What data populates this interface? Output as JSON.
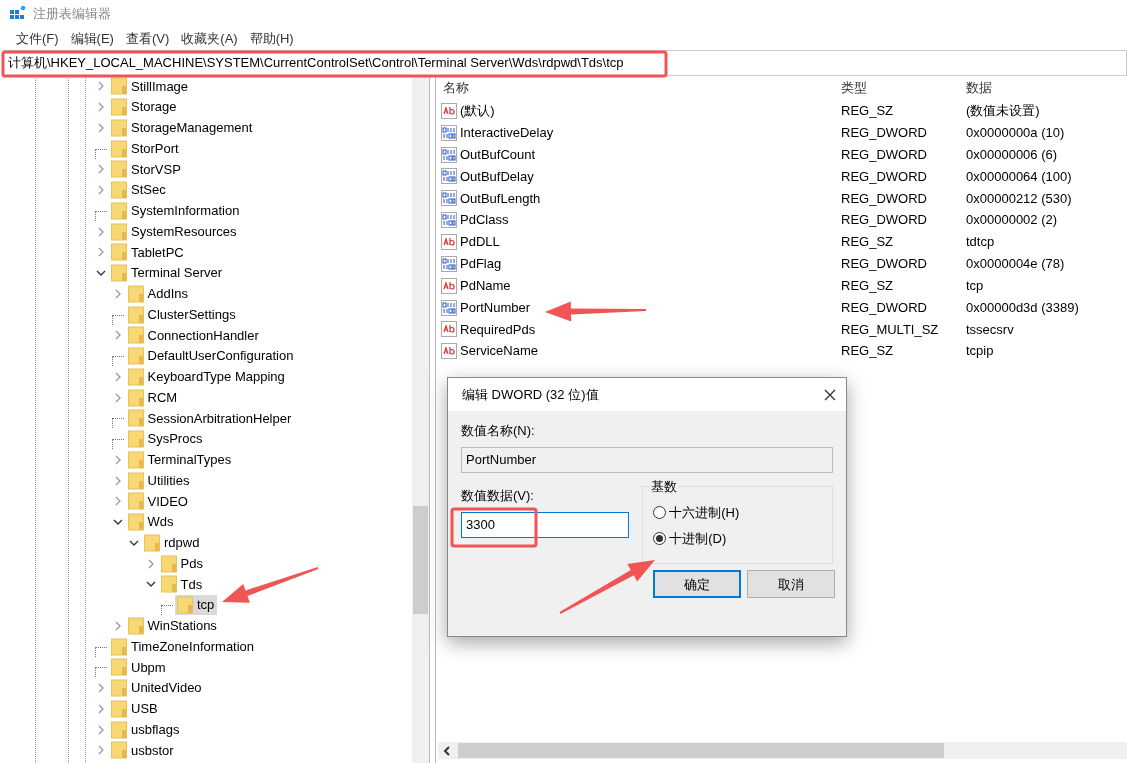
{
  "window": {
    "title": "注册表编辑器"
  },
  "menu": [
    "文件(F)",
    "编辑(E)",
    "查看(V)",
    "收藏夹(A)",
    "帮助(H)"
  ],
  "address": "计算机\\HKEY_LOCAL_MACHINE\\SYSTEM\\CurrentControlSet\\Control\\Terminal Server\\Wds\\rdpwd\\Tds\\tcp",
  "tree": [
    {
      "label": "StillImage",
      "kind": "collapsed",
      "selected": false
    },
    {
      "label": "Storage",
      "kind": "collapsed",
      "selected": false
    },
    {
      "label": "StorageManagement",
      "kind": "collapsed",
      "selected": false
    },
    {
      "label": "StorPort",
      "kind": "leaf",
      "selected": false
    },
    {
      "label": "StorVSP",
      "kind": "collapsed",
      "selected": false
    },
    {
      "label": "StSec",
      "kind": "collapsed",
      "selected": false
    },
    {
      "label": "SystemInformation",
      "kind": "leaf",
      "selected": false
    },
    {
      "label": "SystemResources",
      "kind": "collapsed",
      "selected": false
    },
    {
      "label": "TabletPC",
      "kind": "collapsed",
      "selected": false
    },
    {
      "label": "Terminal Server",
      "kind": "expanded",
      "selected": false,
      "children": [
        {
          "label": "AddIns",
          "kind": "collapsed",
          "selected": false
        },
        {
          "label": "ClusterSettings",
          "kind": "leaf",
          "selected": false
        },
        {
          "label": "ConnectionHandler",
          "kind": "collapsed",
          "selected": false
        },
        {
          "label": "DefaultUserConfiguration",
          "kind": "leaf",
          "selected": false
        },
        {
          "label": "KeyboardType Mapping",
          "kind": "collapsed",
          "selected": false
        },
        {
          "label": "RCM",
          "kind": "collapsed",
          "selected": false
        },
        {
          "label": "SessionArbitrationHelper",
          "kind": "leaf",
          "selected": false
        },
        {
          "label": "SysProcs",
          "kind": "leaf",
          "selected": false
        },
        {
          "label": "TerminalTypes",
          "kind": "collapsed",
          "selected": false
        },
        {
          "label": "Utilities",
          "kind": "collapsed",
          "selected": false
        },
        {
          "label": "VIDEO",
          "kind": "collapsed",
          "selected": false
        },
        {
          "label": "Wds",
          "kind": "expanded",
          "selected": false,
          "children": [
            {
              "label": "rdpwd",
              "kind": "expanded",
              "selected": false,
              "children": [
                {
                  "label": "Pds",
                  "kind": "collapsed",
                  "selected": false
                },
                {
                  "label": "Tds",
                  "kind": "expanded",
                  "selected": false,
                  "children": [
                    {
                      "label": "tcp",
                      "kind": "leaf",
                      "selected": true
                    }
                  ]
                }
              ]
            }
          ]
        },
        {
          "label": "WinStations",
          "kind": "collapsed",
          "selected": false
        }
      ]
    },
    {
      "label": "TimeZoneInformation",
      "kind": "leaf",
      "selected": false
    },
    {
      "label": "Ubpm",
      "kind": "leaf",
      "selected": false
    },
    {
      "label": "UnitedVideo",
      "kind": "collapsed",
      "selected": false
    },
    {
      "label": "USB",
      "kind": "collapsed",
      "selected": false
    },
    {
      "label": "usbflags",
      "kind": "collapsed",
      "selected": false
    },
    {
      "label": "usbstor",
      "kind": "collapsed",
      "selected": false
    }
  ],
  "values": {
    "columns": [
      "名称",
      "类型",
      "数据"
    ],
    "rows": [
      {
        "kind": "string",
        "name": "(默认)",
        "type": "REG_SZ",
        "data": "(数值未设置)"
      },
      {
        "kind": "number",
        "name": "InteractiveDelay",
        "type": "REG_DWORD",
        "data": "0x0000000a (10)"
      },
      {
        "kind": "number",
        "name": "OutBufCount",
        "type": "REG_DWORD",
        "data": "0x00000006 (6)"
      },
      {
        "kind": "number",
        "name": "OutBufDelay",
        "type": "REG_DWORD",
        "data": "0x00000064 (100)"
      },
      {
        "kind": "number",
        "name": "OutBufLength",
        "type": "REG_DWORD",
        "data": "0x00000212 (530)"
      },
      {
        "kind": "number",
        "name": "PdClass",
        "type": "REG_DWORD",
        "data": "0x00000002 (2)"
      },
      {
        "kind": "string",
        "name": "PdDLL",
        "type": "REG_SZ",
        "data": "tdtcp"
      },
      {
        "kind": "number",
        "name": "PdFlag",
        "type": "REG_DWORD",
        "data": "0x0000004e (78)"
      },
      {
        "kind": "string",
        "name": "PdName",
        "type": "REG_SZ",
        "data": "tcp"
      },
      {
        "kind": "number",
        "name": "PortNumber",
        "type": "REG_DWORD",
        "data": "0x00000d3d (3389)"
      },
      {
        "kind": "string",
        "name": "RequiredPds",
        "type": "REG_MULTI_SZ",
        "data": "tssecsrv"
      },
      {
        "kind": "string",
        "name": "ServiceName",
        "type": "REG_SZ",
        "data": "tcpip"
      }
    ]
  },
  "dialog": {
    "title": "编辑 DWORD (32 位)值",
    "name_label": "数值名称(N):",
    "name_value": "PortNumber",
    "data_label": "数值数据(V):",
    "data_value": "3300",
    "base_label": "基数",
    "radios": [
      {
        "label": "十六进制(H)",
        "selected": false
      },
      {
        "label": "十进制(D)",
        "selected": true
      }
    ],
    "buttons": [
      {
        "label": "确定",
        "default": true
      },
      {
        "label": "取消",
        "default": false
      }
    ]
  }
}
